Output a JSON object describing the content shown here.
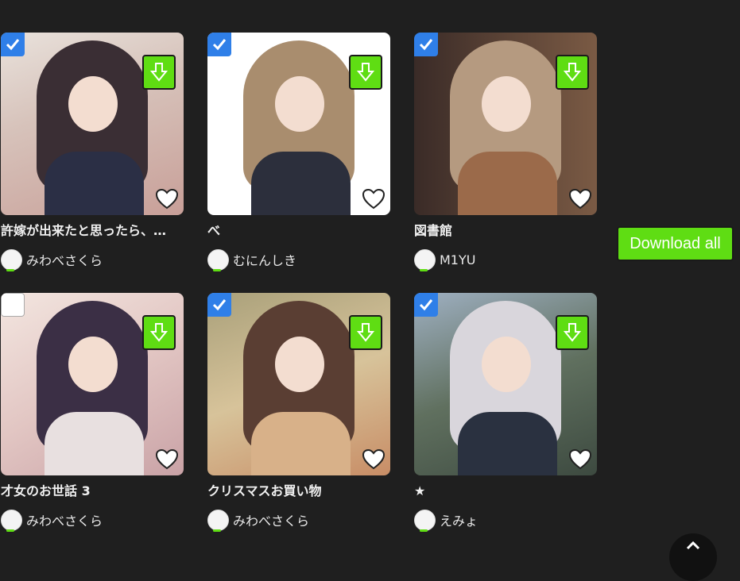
{
  "colors": {
    "background": "#1f1f1f",
    "accent_green": "#5fdd13",
    "check_blue": "#2f7fe8"
  },
  "download_all_label": "Download all",
  "cards": [
    {
      "title": "許嫁が出来たと思ったら、…",
      "author": "みわべさくら",
      "checked": true,
      "icons": [
        "checkbox-icon",
        "download-icon",
        "heart-icon"
      ]
    },
    {
      "title": "べ",
      "author": "むにんしき",
      "checked": true
    },
    {
      "title": "図書館",
      "author": "M1YU",
      "checked": true
    },
    {
      "title": "才女のお世話 3",
      "author": "みわべさくら",
      "checked": false
    },
    {
      "title": "クリスマスお買い物",
      "author": "みわべさくら",
      "checked": true
    },
    {
      "title": "★",
      "author": "えみょ",
      "checked": true
    }
  ]
}
